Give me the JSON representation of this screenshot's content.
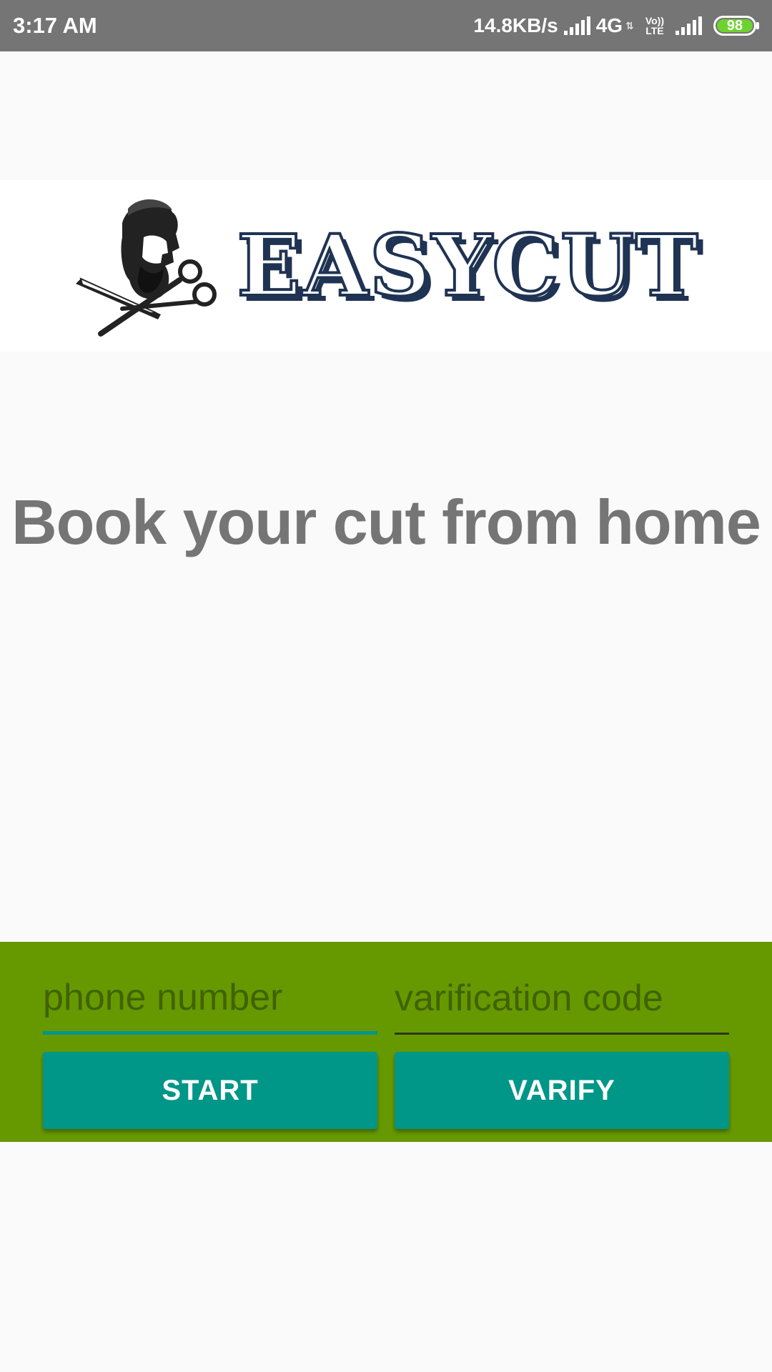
{
  "status_bar": {
    "time": "3:17 AM",
    "net_speed": "14.8KB/s",
    "network": "4G",
    "volte_top": "Vo))",
    "volte_bottom": "LTE",
    "battery": "98",
    "battery_color": "#6DD22E"
  },
  "logo": {
    "brand": "EASYCUT",
    "emblem_icon": "barber-scissors-razor-icon",
    "brand_color": "#1F3353"
  },
  "tagline": "Book your cut from home",
  "form": {
    "phone_placeholder": "phone number",
    "code_placeholder": "varification code",
    "start_label": "START",
    "verify_label": "VARIFY",
    "panel_color": "#669900",
    "accent_color": "#009688"
  }
}
